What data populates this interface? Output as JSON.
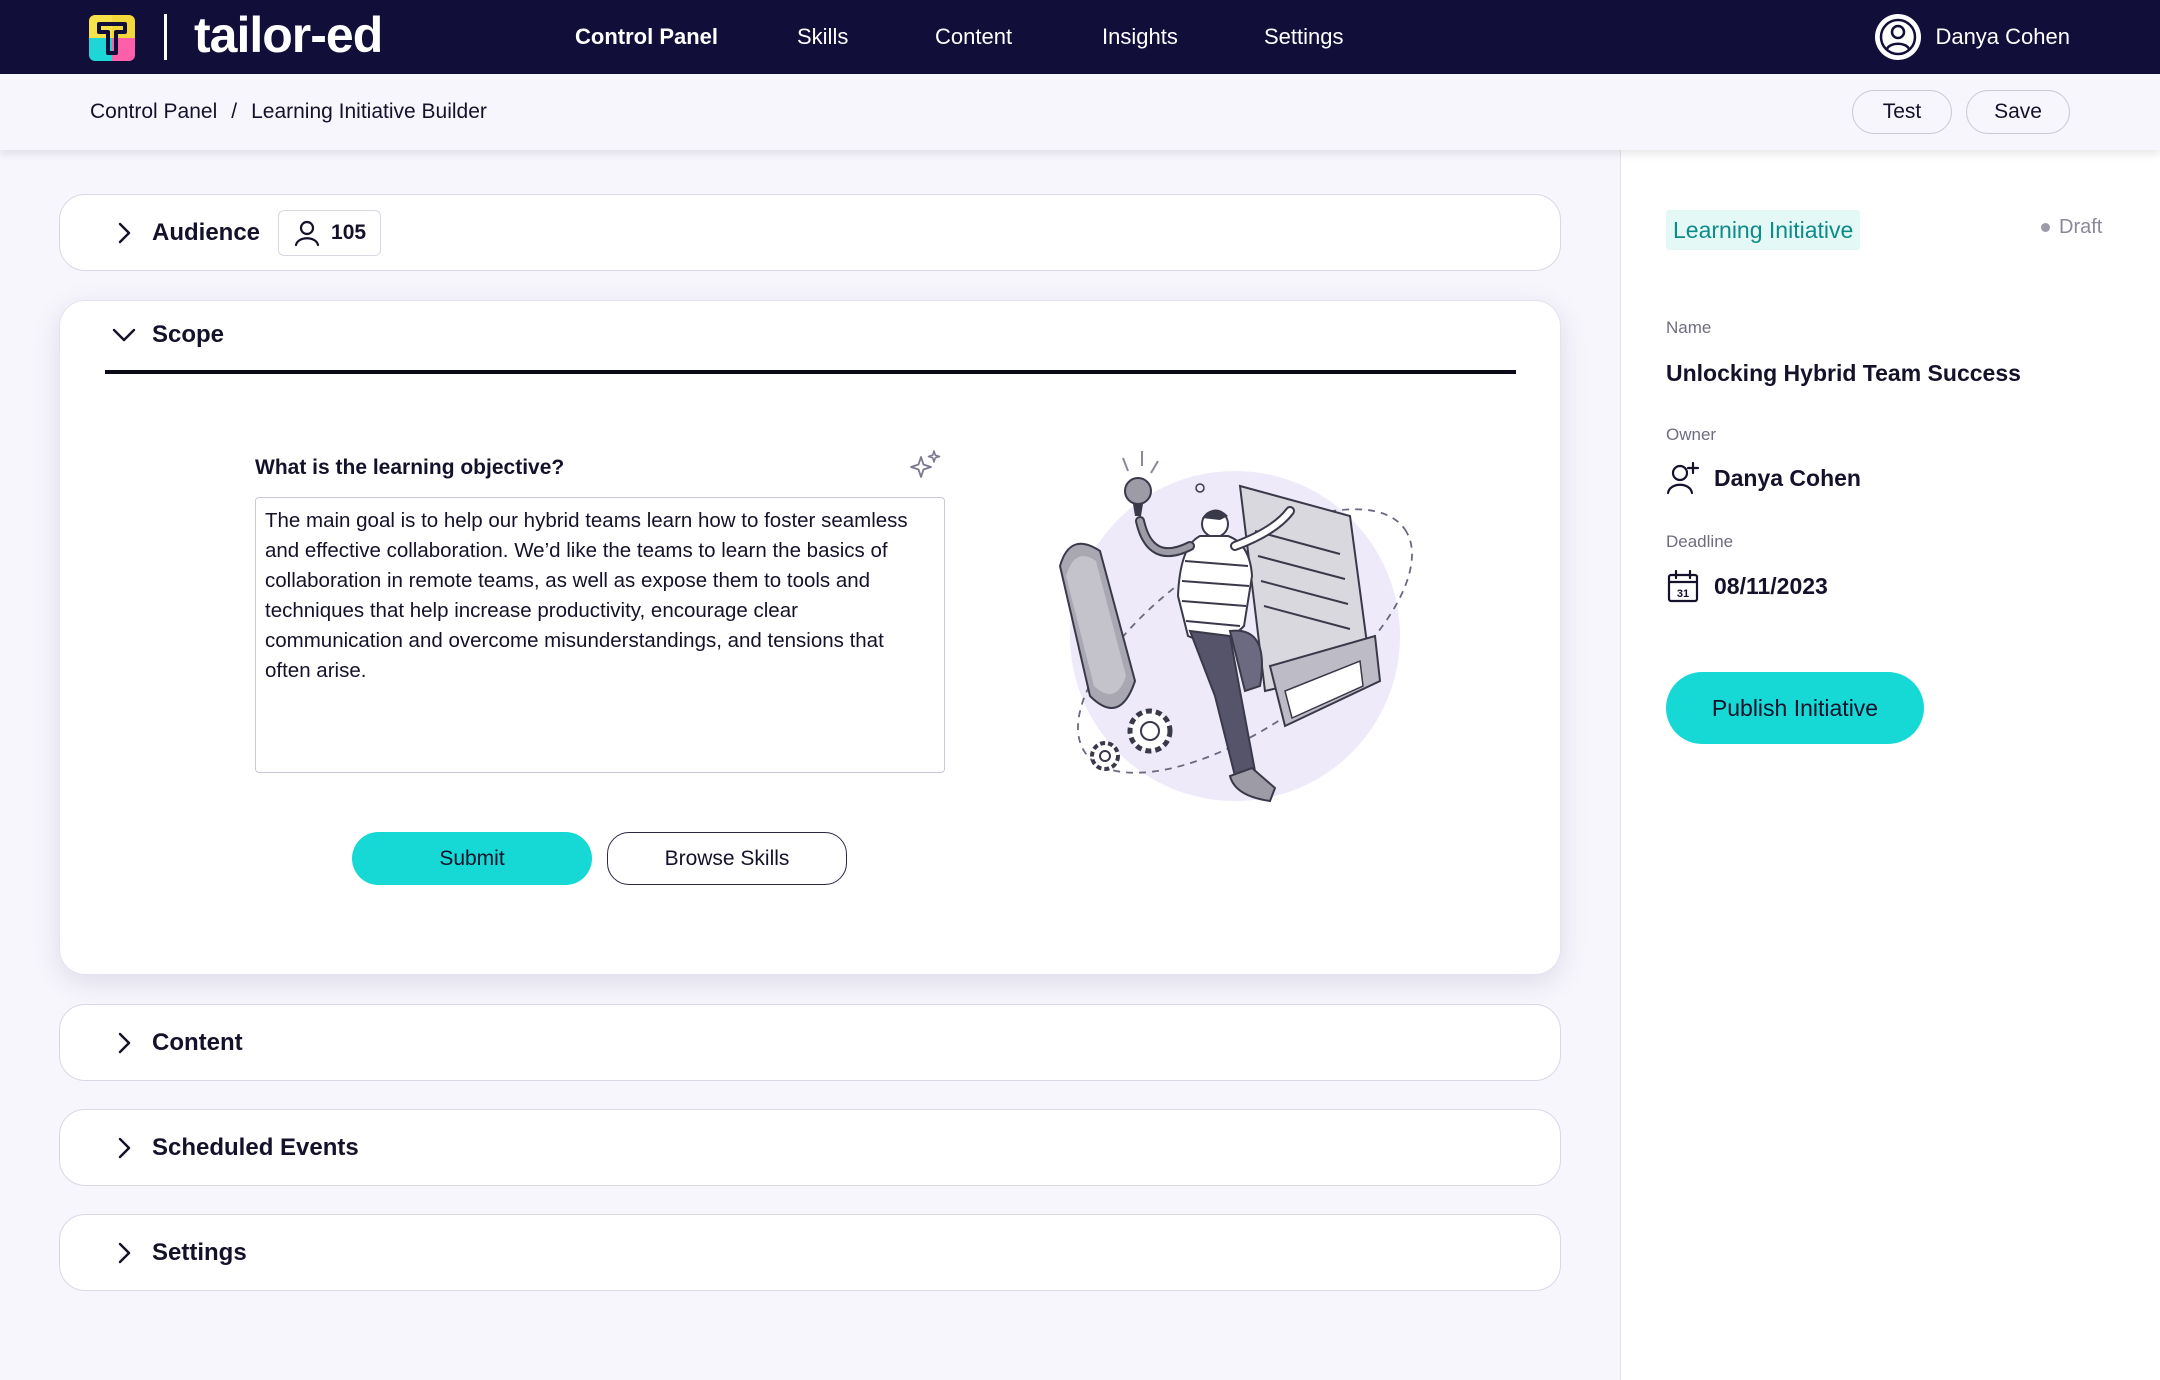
{
  "app": {
    "brand": "tailor-ed",
    "user_name": "Danya Cohen"
  },
  "nav": {
    "items": [
      "Control Panel",
      "Skills",
      "Content",
      "Insights",
      "Settings"
    ],
    "active": "Control Panel"
  },
  "breadcrumb": {
    "root": "Control Panel",
    "separator": "/",
    "current": "Learning Initiative Builder"
  },
  "toolbar": {
    "test_label": "Test",
    "save_label": "Save"
  },
  "sections": {
    "audience": {
      "title": "Audience",
      "count": "105"
    },
    "scope": {
      "title": "Scope",
      "question": "What is the learning objective?",
      "objective_text": "The main goal is to help our hybrid teams learn how to foster seamless and effective collaboration. We’d like the teams to learn the basics of collaboration in remote teams, as well as expose them to tools and techniques that help increase productivity, encourage clear communication and overcome misunderstandings, and tensions that often arise.",
      "submit_label": "Submit",
      "browse_label": "Browse Skills"
    },
    "content": {
      "title": "Content"
    },
    "scheduled_events": {
      "title": "Scheduled Events"
    },
    "settings": {
      "title": "Settings"
    }
  },
  "side_panel": {
    "type_chip": "Learning Initiative",
    "status": "Draft",
    "name_label": "Name",
    "name_value": "Unlocking Hybrid Team Success",
    "owner_label": "Owner",
    "owner_value": "Danya Cohen",
    "deadline_label": "Deadline",
    "deadline_value": "08/11/2023",
    "calendar_day": "31",
    "publish_label": "Publish Initiative"
  },
  "colors": {
    "nav_bg": "#120e3a",
    "accent": "#16d9d6",
    "chip_bg": "#e4f8f6",
    "chip_text": "#0d8b89",
    "page_bg": "#f7f6fc"
  },
  "icons": [
    "logo-mark-icon",
    "user-avatar-icon",
    "chevron-right-icon",
    "chevron-down-icon",
    "person-icon",
    "sparkle-icon",
    "person-add-icon",
    "calendar-icon"
  ]
}
